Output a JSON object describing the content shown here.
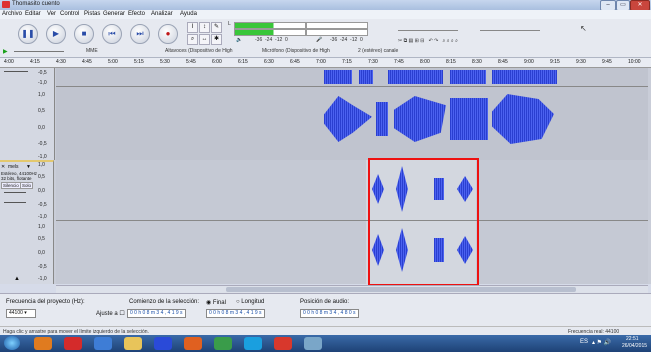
{
  "window": {
    "title": "Thomasito cuento",
    "min": "–",
    "max": "▭",
    "close": "✕"
  },
  "menu": [
    "Archivo",
    "Editar",
    "Ver",
    "Control",
    "Pistas",
    "Generar",
    "Efecto",
    "Analizar",
    "Ayuda"
  ],
  "meters": {
    "ticks1": [
      "-36",
      "-24",
      "-12",
      "0"
    ],
    "ticks2": [
      "-36",
      "-24",
      "-12",
      "0"
    ],
    "lr1": [
      "L",
      "R"
    ],
    "lr2": [
      "L",
      "R"
    ]
  },
  "device": {
    "host": "MME",
    "output": "Altavoces (Dispositivo de High",
    "input": "Micrófono (Dispositivo de High",
    "channels": "2 (estéreo) canale"
  },
  "ruler": [
    "4:00",
    "4:15",
    "4:30",
    "4:45",
    "5:00",
    "5:15",
    "5:30",
    "5:45",
    "6:00",
    "6:15",
    "6:30",
    "6:45",
    "7:00",
    "7:15",
    "7:30",
    "7:45",
    "8:00",
    "8:15",
    "8:30",
    "8:45",
    "9:00",
    "9:15",
    "9:30",
    "9:45",
    "10:00"
  ],
  "track1": {
    "scale": [
      "-0,5",
      "-1,0",
      "1,0",
      "0,5",
      "0,0",
      "-0,5",
      "-1,0"
    ]
  },
  "track2": {
    "name": "mels",
    "info": [
      "Estéreo, 44100Hz",
      "32 bits, flotante"
    ],
    "silence": "Silencio",
    "solo": "Solo",
    "scale_top": [
      "1,0",
      "0,5",
      "0,0",
      "-0,5",
      "-1,0"
    ],
    "scale_bot": [
      "1,0",
      "0,5",
      "0,0",
      "-0,5",
      "-1,0"
    ]
  },
  "bottom": {
    "rate_label": "Frecuencia del proyecto (Hz):",
    "rate_value": "44100",
    "sel_start_label": "Comienzo de la selección:",
    "end_label": "Final",
    "length_label": "Longitud",
    "snap_label": "Ajuste a",
    "pos_label": "Posición de audio:",
    "time1": "0 0 h 0 8 m 3 4 , 4 1 9 s",
    "time2": "0 0 h 0 8 m 3 4 , 4 1 9 s",
    "time3": "0 0 h 0 8 m 3 4 , 4 8 0 s"
  },
  "status": {
    "hint": "Haga clic y arrastre para mover el límite izquierdo de la selección.",
    "rate": "Frecuencia real: 44100"
  },
  "taskbar": {
    "lang": "ES",
    "time": "22:51",
    "date": "26/04/2015"
  }
}
